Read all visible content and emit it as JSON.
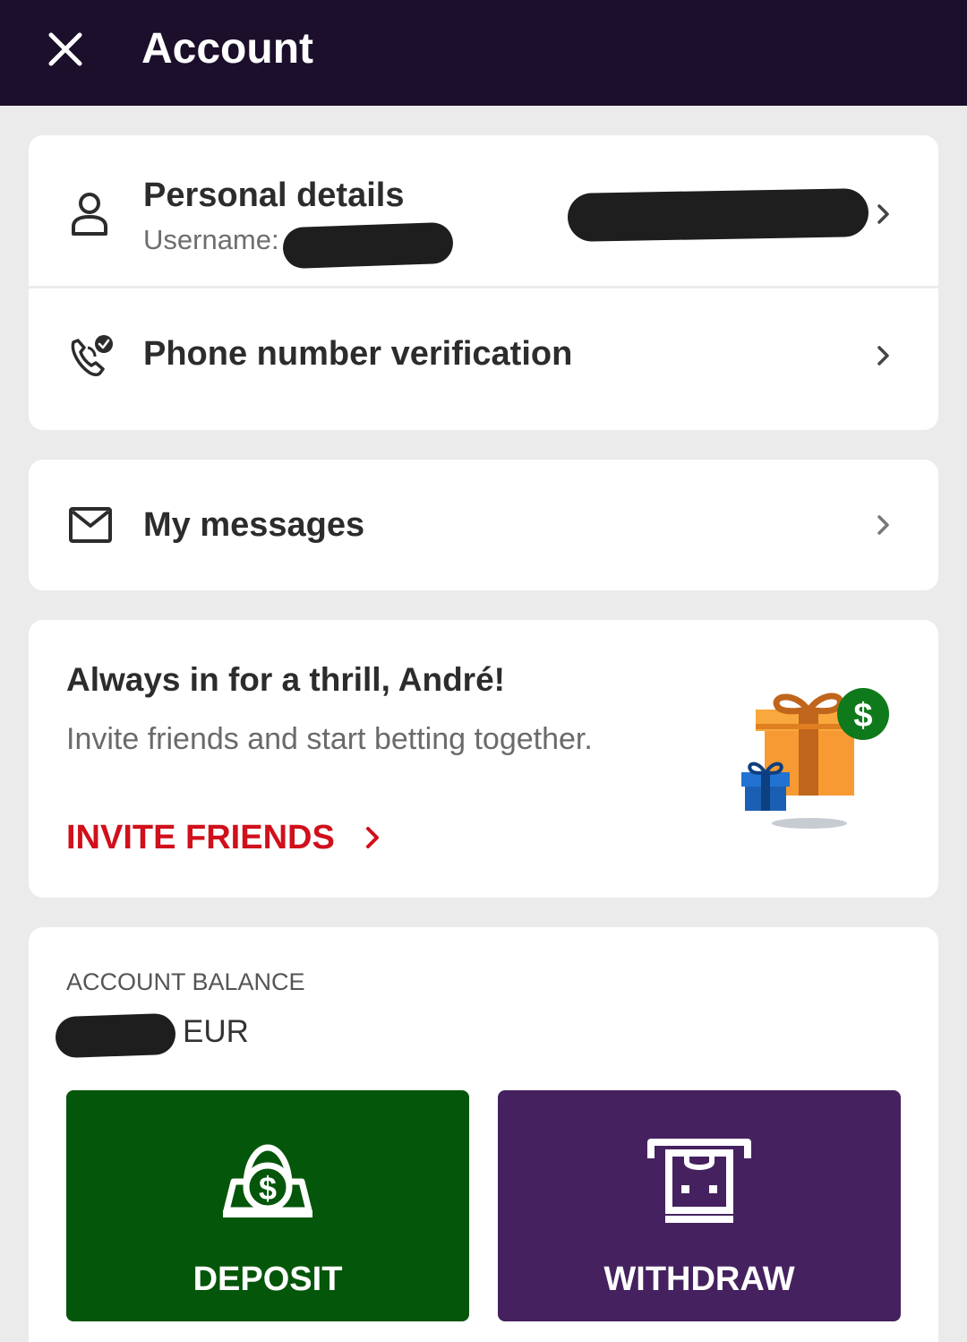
{
  "header": {
    "title": "Account",
    "close_icon": "close-icon",
    "background": "#1c0f2b"
  },
  "account_card": {
    "personal_details": {
      "title": "Personal details",
      "username_label": "Username:",
      "icon": "person-icon"
    },
    "phone_verification": {
      "label": "Phone number verification",
      "icon": "phone-verified-icon"
    }
  },
  "messages_card": {
    "label": "My messages",
    "icon": "mail-icon"
  },
  "promo_card": {
    "title": "Always in for a thrill, André!",
    "subtitle": "Invite friends and start betting together.",
    "link_label": "INVITE FRIENDS",
    "link_color": "#d0101b",
    "illustration": "gift-icon"
  },
  "balance_card": {
    "label": "ACCOUNT BALANCE",
    "currency": "EUR",
    "deposit": {
      "label": "DEPOSIT",
      "icon": "cash-icon",
      "color": "#04560a"
    },
    "withdraw": {
      "label": "WITHDRAW",
      "icon": "atm-withdraw-icon",
      "color": "#45225f"
    }
  }
}
